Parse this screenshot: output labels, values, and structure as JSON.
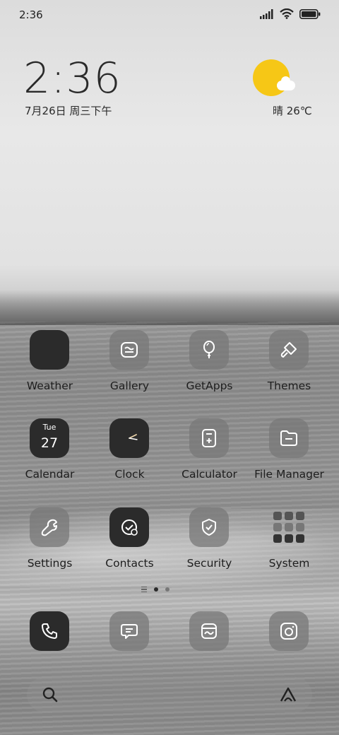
{
  "status_bar": {
    "time": "2:36",
    "icons": [
      "signal-icon",
      "wifi-icon",
      "battery-icon"
    ]
  },
  "lock_clock": {
    "time": "2:36",
    "date": "7月26日 周三下午"
  },
  "weather": {
    "text": "晴 26℃",
    "icon": "sun-cloud-icon",
    "sun_color": "#f6c716"
  },
  "apps": {
    "row1": [
      {
        "label": "Weather",
        "icon": "weather-icon"
      },
      {
        "label": "Gallery",
        "icon": "gallery-icon"
      },
      {
        "label": "GetApps",
        "icon": "balloon-icon"
      },
      {
        "label": "Themes",
        "icon": "brush-icon"
      }
    ],
    "row2": [
      {
        "label": "Calendar",
        "icon": "calendar-icon",
        "day": "Tue",
        "date": "27"
      },
      {
        "label": "Clock",
        "icon": "clock-icon"
      },
      {
        "label": "Calculator",
        "icon": "calculator-icon"
      },
      {
        "label": "File Manager",
        "icon": "folder-icon"
      }
    ],
    "row3": [
      {
        "label": "Settings",
        "icon": "wrench-icon"
      },
      {
        "label": "Contacts",
        "icon": "contacts-icon"
      },
      {
        "label": "Security",
        "icon": "shield-icon"
      },
      {
        "label": "System",
        "icon": "system-folder-icon"
      }
    ]
  },
  "page_indicator": {
    "pages": 2,
    "current": 1
  },
  "dock": [
    {
      "name": "phone",
      "icon": "phone-icon"
    },
    {
      "name": "messages",
      "icon": "message-icon"
    },
    {
      "name": "browser",
      "icon": "browser-icon"
    },
    {
      "name": "camera",
      "icon": "camera-icon"
    }
  ],
  "search": {
    "icon": "search-icon",
    "assistant_icon": "assistant-icon"
  },
  "colors": {
    "dark_icon": "#2b2b2b",
    "gray_icon": "#787878",
    "text": "#1e1e1e"
  }
}
